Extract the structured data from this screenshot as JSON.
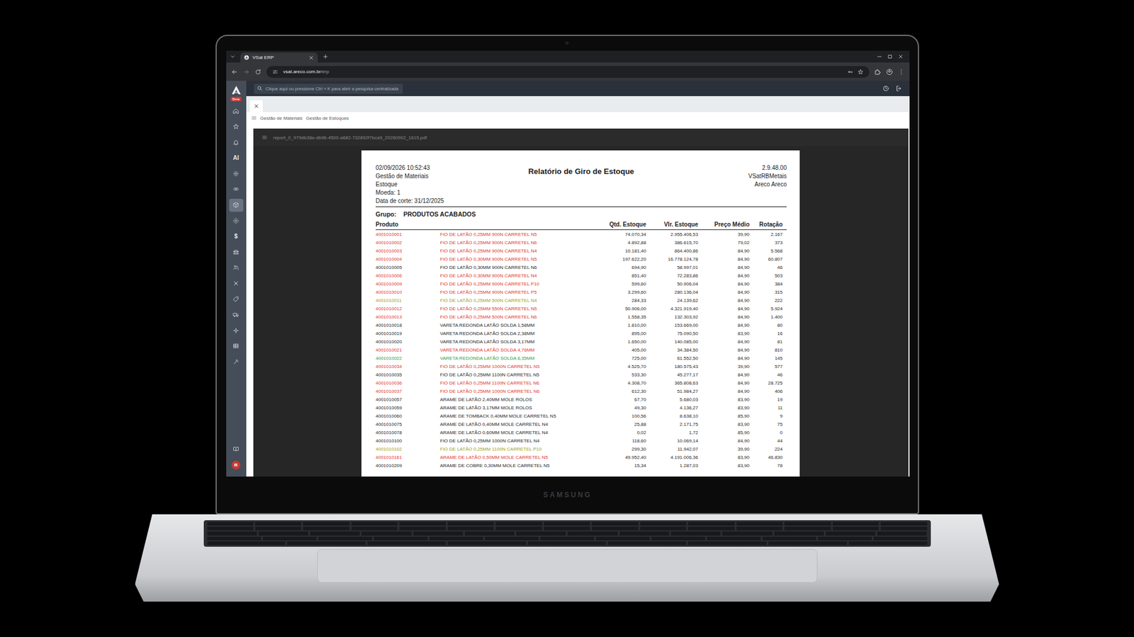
{
  "browser": {
    "tabs": [
      {
        "title": "VSat ERP",
        "selected": true
      }
    ],
    "url": {
      "host": "vsat.areco.com.br",
      "path": "/erp"
    }
  },
  "app": {
    "badge": "Beta",
    "search": {
      "placeholder": "Clique aqui ou pressione Ctrl + K para abrir a pesquisa centralizada"
    },
    "sidebar": {
      "items": [
        {
          "kind": "icon",
          "selected": false
        },
        {
          "kind": "icon",
          "selected": false
        },
        {
          "kind": "icon",
          "selected": false
        },
        {
          "kind": "text",
          "label": "AI",
          "selected": false
        },
        {
          "kind": "icon",
          "selected": false
        },
        {
          "kind": "icon",
          "selected": false
        },
        {
          "kind": "icon",
          "selected": true
        },
        {
          "kind": "icon",
          "selected": false
        },
        {
          "kind": "text",
          "label": "$",
          "selected": false
        },
        {
          "kind": "icon",
          "selected": false
        },
        {
          "kind": "icon",
          "selected": false
        },
        {
          "kind": "icon",
          "selected": false
        },
        {
          "kind": "icon",
          "selected": false
        },
        {
          "kind": "icon",
          "selected": false
        },
        {
          "kind": "icon",
          "selected": false
        },
        {
          "kind": "icon",
          "selected": false
        },
        {
          "kind": "icon",
          "selected": false
        }
      ],
      "avatar": "R"
    },
    "breadcrumb": [
      "Gestão de Materiais",
      "Gestão de Estoques"
    ],
    "viewer": {
      "filename": "report_0_979db38e-db96-4500-a682-732892f7bca9_20260902_1615.pdf"
    }
  },
  "report": {
    "meta_left": [
      "02/09/2026 10:52:43",
      "Gestão de Materiais",
      "Estoque",
      "Moeda: 1",
      "Data de corte: 31/12/2025"
    ],
    "title": "Relatório de Giro de Estoque",
    "meta_right": [
      "2.9.48.00",
      "VSatRBMetais",
      "Areco Areco"
    ],
    "group_label": "Grupo:",
    "group": "PRODUTOS ACABADOS",
    "columns": [
      "Produto",
      "Qtd. Estoque",
      "Vlr. Estoque",
      "Preço Médio",
      "Rotação"
    ],
    "rows": [
      {
        "code": "4001010001",
        "description": "FIO DE LATÃO 0,25MM 900N CARRETEL N5",
        "qty": "74.070,34",
        "value": "2.955.406,53",
        "avg_price": "39,90",
        "rotation": "2.167",
        "color": "#e0352b"
      },
      {
        "code": "4001010002",
        "description": "FIO DE LATÃO 0,25MM 900N CARRETEL N6",
        "qty": "4.892,88",
        "value": "386.615,70",
        "avg_price": "79,02",
        "rotation": "373",
        "color": "#e0352b"
      },
      {
        "code": "4001010003",
        "description": "FIO DE LATÃO 0,25MM 900N CARRETEL N4",
        "qty": "10.181,40",
        "value": "864.400,86",
        "avg_price": "84,90",
        "rotation": "5.568",
        "color": "#e0352b"
      },
      {
        "code": "4001010004",
        "description": "FIO DE LATÃO 0,30MM 900N CARRETEL N5",
        "qty": "197.622,20",
        "value": "16.778.124,78",
        "avg_price": "84,90",
        "rotation": "60.807",
        "color": "#e0352b"
      },
      {
        "code": "4001010005",
        "description": "FIO DE LATÃO 0,30MM 900N CARRETEL N6",
        "qty": "694,90",
        "value": "58.997,01",
        "avg_price": "84,90",
        "rotation": "46",
        "color": "#1e1e1e"
      },
      {
        "code": "4001010006",
        "description": "FIO DE LATÃO 0,30MM 900N CARRETEL N4",
        "qty": "851,40",
        "value": "72.283,86",
        "avg_price": "84,90",
        "rotation": "503",
        "color": "#e0352b"
      },
      {
        "code": "4001010009",
        "description": "FIO DE LATÃO 0,25MM 900N CARRETEL P10",
        "qty": "599,60",
        "value": "50.906,04",
        "avg_price": "84,90",
        "rotation": "384",
        "color": "#e0352b"
      },
      {
        "code": "4001010010",
        "description": "FIO DE LATÃO 0,25MM 900N CARRETEL P5",
        "qty": "3.299,60",
        "value": "280.136,04",
        "avg_price": "84,90",
        "rotation": "315",
        "color": "#e0352b"
      },
      {
        "code": "4001010011",
        "description": "FIO DE LATÃO 0,25MM 500N CARRETEL N4",
        "qty": "284,33",
        "value": "24.139,62",
        "avg_price": "84,90",
        "rotation": "222",
        "color": "#9c9e16"
      },
      {
        "code": "4001010012",
        "description": "FIO DE LATÃO 0,25MM 550N CARRETEL N5",
        "qty": "50.906,00",
        "value": "4.321.919,40",
        "avg_price": "84,90",
        "rotation": "5.924",
        "color": "#e0352b"
      },
      {
        "code": "4001010013",
        "description": "FIO DE LATÃO 0,25MM 500N CARRETEL N6",
        "qty": "1.558,35",
        "value": "132.303,92",
        "avg_price": "84,90",
        "rotation": "1.400",
        "color": "#e0352b"
      },
      {
        "code": "4001010018",
        "description": "VARETA REDONDA LATÃO SOLDA 1,58MM",
        "qty": "1.810,00",
        "value": "153.669,00",
        "avg_price": "84,90",
        "rotation": "80",
        "color": "#1e1e1e"
      },
      {
        "code": "4001010019",
        "description": "VARETA REDONDA LATÃO SOLDA 2,38MM",
        "qty": "895,00",
        "value": "75.090,50",
        "avg_price": "83,90",
        "rotation": "16",
        "color": "#1e1e1e"
      },
      {
        "code": "4001010020",
        "description": "VARETA REDONDA LATÃO SOLDA 3,17MM",
        "qty": "1.650,00",
        "value": "140.085,00",
        "avg_price": "84,90",
        "rotation": "81",
        "color": "#1e1e1e"
      },
      {
        "code": "4001010021",
        "description": "VARETA REDONDA LATÃO SOLDA 4,76MM",
        "qty": "405,00",
        "value": "34.384,50",
        "avg_price": "84,90",
        "rotation": "810",
        "color": "#e0352b"
      },
      {
        "code": "4001010022",
        "description": "VARETA REDONDA LATÃO SOLDA 6,35MM",
        "qty": "725,00",
        "value": "61.552,50",
        "avg_price": "84,90",
        "rotation": "145",
        "color": "#2f9a3a"
      },
      {
        "code": "4001010034",
        "description": "FIO DE LATÃO 0,25MM 1000N CARRETEL N5",
        "qty": "4.525,70",
        "value": "180.575,43",
        "avg_price": "39,90",
        "rotation": "577",
        "color": "#e0352b"
      },
      {
        "code": "4001010035",
        "description": "FIO DE LATÃO 0,25MM 1100N CARRETEL N5",
        "qty": "533,30",
        "value": "45.277,17",
        "avg_price": "84,90",
        "rotation": "46",
        "color": "#1e1e1e"
      },
      {
        "code": "4001010036",
        "description": "FIO DE LATÃO 0,25MM 1100N CARRETEL N6",
        "qty": "4.308,70",
        "value": "365.808,63",
        "avg_price": "84,90",
        "rotation": "28.725",
        "color": "#e0352b"
      },
      {
        "code": "4001010037",
        "description": "FIO DE LATÃO 0,25MM 1000N CARRETEL N6",
        "qty": "612,30",
        "value": "51.984,27",
        "avg_price": "84,90",
        "rotation": "406",
        "color": "#e0352b"
      },
      {
        "code": "4001010057",
        "description": "ARAME DE LATÃO 2,40MM MOLE ROLOS",
        "qty": "67,70",
        "value": "5.680,03",
        "avg_price": "83,90",
        "rotation": "19",
        "color": "#1e1e1e"
      },
      {
        "code": "4001010059",
        "description": "ARAME DE LATÃO 3,17MM MOLE ROLOS",
        "qty": "49,30",
        "value": "4.136,27",
        "avg_price": "83,90",
        "rotation": "11",
        "color": "#1e1e1e"
      },
      {
        "code": "4001010060",
        "description": "ARAME DE TOMBACK 0,40MM MOLE CARRETEL N5",
        "qty": "100,56",
        "value": "8.638,10",
        "avg_price": "85,90",
        "rotation": "9",
        "color": "#1e1e1e"
      },
      {
        "code": "4001010075",
        "description": "ARAME DE LATÃO 0,40MM MOLE CARRETEL N4",
        "qty": "25,88",
        "value": "2.171,75",
        "avg_price": "83,90",
        "rotation": "75",
        "color": "#1e1e1e"
      },
      {
        "code": "4001010078",
        "description": "ARAME DE LATÃO 0,60MM MOLE CARRETEL N4",
        "qty": "0,02",
        "value": "1,72",
        "avg_price": "85,90",
        "rotation": "0",
        "color": "#1e1e1e"
      },
      {
        "code": "4001010100",
        "description": "FIO DE LATÃO 0,25MM 1000N CARRETEL N4",
        "qty": "118,60",
        "value": "10.069,14",
        "avg_price": "84,90",
        "rotation": "44",
        "color": "#1e1e1e"
      },
      {
        "code": "4001010102",
        "description": "FIO DE LATÃO 0,25MM 1100N CARRETEL P10",
        "qty": "299,30",
        "value": "11.942,07",
        "avg_price": "39,90",
        "rotation": "224",
        "color": "#9c9e16"
      },
      {
        "code": "4001010161",
        "description": "ARAME DE LATÃO 0,50MM MOLE CARRETEL N5",
        "qty": "49.952,40",
        "value": "4.191.006,36",
        "avg_price": "83,90",
        "rotation": "46.830",
        "color": "#e0352b"
      },
      {
        "code": "4001010209",
        "description": "ARAME DE COBRE 0,30MM MOLE CARRETEL N5",
        "qty": "15,34",
        "value": "1.287,03",
        "avg_price": "83,90",
        "rotation": "78",
        "color": "#1e1e1e"
      }
    ]
  },
  "device": {
    "brand": "SAMSUNG"
  }
}
